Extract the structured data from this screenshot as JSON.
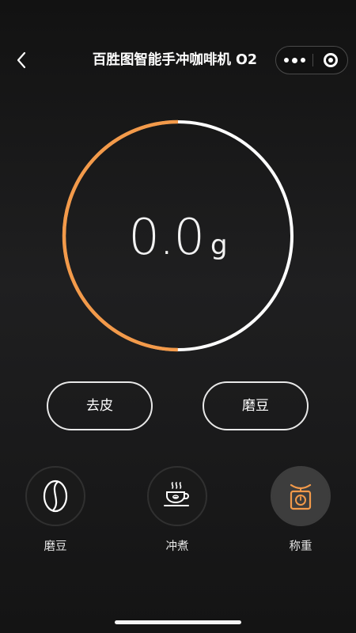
{
  "navbar": {
    "title": "百胜图智能手冲咖啡机 O2",
    "back_icon": "chevron-left-icon",
    "more_icon": "more-dots-icon",
    "close_icon": "target-circle-icon"
  },
  "scale": {
    "value": "0.0",
    "unit": "g",
    "progress_fraction": 0.5,
    "progress_color": "#f39a4a",
    "track_color": "#ffffff"
  },
  "actions": {
    "tare_label": "去皮",
    "grind_label": "磨豆"
  },
  "modes": [
    {
      "label": "磨豆",
      "icon": "coffee-bean-icon",
      "active": false
    },
    {
      "label": "冲煮",
      "icon": "coffee-cup-icon",
      "active": false
    },
    {
      "label": "称重",
      "icon": "kitchen-scale-icon",
      "active": true
    }
  ],
  "colors": {
    "accent": "#f39a4a",
    "background": "#1c1c1d"
  }
}
